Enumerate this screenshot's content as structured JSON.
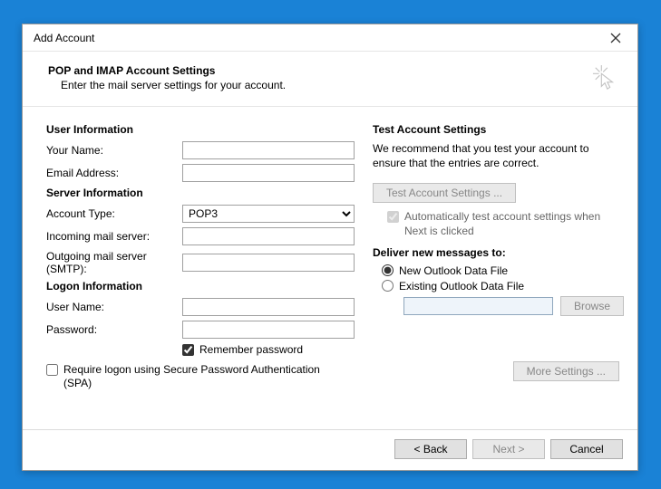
{
  "title": "Add Account",
  "header": {
    "heading": "POP and IMAP Account Settings",
    "sub": "Enter the mail server settings for your account."
  },
  "sections": {
    "user_info": "User Information",
    "server_info": "Server Information",
    "logon_info": "Logon Information",
    "test": "Test Account Settings",
    "deliver": "Deliver new messages to:"
  },
  "labels": {
    "your_name": "Your Name:",
    "email": "Email Address:",
    "account_type": "Account Type:",
    "incoming": "Incoming mail server:",
    "outgoing": "Outgoing mail server (SMTP):",
    "user_name": "User Name:",
    "password": "Password:",
    "remember": "Remember password",
    "spa": "Require logon using Secure Password Authentication (SPA)",
    "test_desc": "We recommend that you test your account to ensure that the entries are correct.",
    "test_btn": "Test Account Settings ...",
    "auto_test": "Automatically test account settings when Next is clicked",
    "new_file": "New Outlook Data File",
    "existing_file": "Existing Outlook Data File",
    "browse": "Browse",
    "more": "More Settings ..."
  },
  "values": {
    "your_name": "",
    "email": "",
    "account_type": "POP3",
    "incoming": "",
    "outgoing": "",
    "user_name": "",
    "password": "",
    "remember_checked": true,
    "spa_checked": false,
    "auto_test_checked": true,
    "deliver_selected": "new",
    "existing_path": ""
  },
  "footer": {
    "back": "< Back",
    "next": "Next >",
    "cancel": "Cancel"
  }
}
